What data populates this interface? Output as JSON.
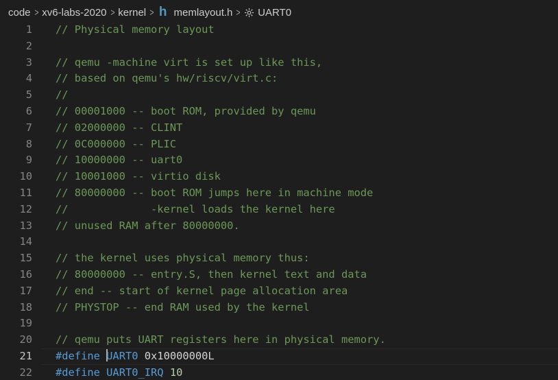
{
  "breadcrumb": {
    "items": [
      "code",
      "xv6-labs-2020",
      "kernel"
    ],
    "file_icon": "h",
    "file_name": "memlayout.h",
    "symbol_icon": "gear-icon",
    "symbol_name": "UART0",
    "separator": ">"
  },
  "editor": {
    "active_line": 21,
    "lines": [
      {
        "number": "1",
        "tokens": [
          {
            "type": "comment",
            "text": "// Physical memory layout"
          }
        ]
      },
      {
        "number": "2",
        "tokens": []
      },
      {
        "number": "3",
        "tokens": [
          {
            "type": "comment",
            "text": "// qemu -machine virt is set up like this,"
          }
        ]
      },
      {
        "number": "4",
        "tokens": [
          {
            "type": "comment",
            "text": "// based on qemu's hw/riscv/virt.c:"
          }
        ]
      },
      {
        "number": "5",
        "tokens": [
          {
            "type": "comment",
            "text": "//"
          }
        ]
      },
      {
        "number": "6",
        "tokens": [
          {
            "type": "comment",
            "text": "// 00001000 -- boot ROM, provided by qemu"
          }
        ]
      },
      {
        "number": "7",
        "tokens": [
          {
            "type": "comment",
            "text": "// 02000000 -- CLINT"
          }
        ]
      },
      {
        "number": "8",
        "tokens": [
          {
            "type": "comment",
            "text": "// 0C000000 -- PLIC"
          }
        ]
      },
      {
        "number": "9",
        "tokens": [
          {
            "type": "comment",
            "text": "// 10000000 -- uart0"
          }
        ]
      },
      {
        "number": "10",
        "tokens": [
          {
            "type": "comment",
            "text": "// 10001000 -- virtio disk"
          }
        ]
      },
      {
        "number": "11",
        "tokens": [
          {
            "type": "comment",
            "text": "// 80000000 -- boot ROM jumps here in machine mode"
          }
        ]
      },
      {
        "number": "12",
        "tokens": [
          {
            "type": "comment",
            "text": "//             -kernel loads the kernel here"
          }
        ]
      },
      {
        "number": "13",
        "tokens": [
          {
            "type": "comment",
            "text": "// unused RAM after 80000000."
          }
        ]
      },
      {
        "number": "14",
        "tokens": []
      },
      {
        "number": "15",
        "tokens": [
          {
            "type": "comment",
            "text": "// the kernel uses physical memory thus:"
          }
        ]
      },
      {
        "number": "16",
        "tokens": [
          {
            "type": "comment",
            "text": "// 80000000 -- entry.S, then kernel text and data"
          }
        ]
      },
      {
        "number": "17",
        "tokens": [
          {
            "type": "comment",
            "text": "// end -- start of kernel page allocation area"
          }
        ]
      },
      {
        "number": "18",
        "tokens": [
          {
            "type": "comment",
            "text": "// PHYSTOP -- end RAM used by the kernel"
          }
        ]
      },
      {
        "number": "19",
        "tokens": []
      },
      {
        "number": "20",
        "tokens": [
          {
            "type": "comment",
            "text": "// qemu puts UART registers here in physical memory."
          }
        ]
      },
      {
        "number": "21",
        "tokens": [
          {
            "type": "keyword",
            "text": "#define"
          },
          {
            "type": "text",
            "text": " "
          },
          {
            "type": "cursor",
            "text": ""
          },
          {
            "type": "macro",
            "text": "UART0"
          },
          {
            "type": "text",
            "text": " 0x10000000L"
          }
        ]
      },
      {
        "number": "22",
        "tokens": [
          {
            "type": "keyword",
            "text": "#define"
          },
          {
            "type": "text",
            "text": " "
          },
          {
            "type": "macro",
            "text": "UART0_IRQ"
          },
          {
            "type": "text",
            "text": " "
          },
          {
            "type": "number",
            "text": "10"
          }
        ]
      }
    ]
  },
  "colors": {
    "background": "#1e1e1e",
    "comment": "#6a9955",
    "keyword": "#569cd6",
    "number": "#b5cea8",
    "line_number": "#858585",
    "file_icon": "#519aba"
  }
}
